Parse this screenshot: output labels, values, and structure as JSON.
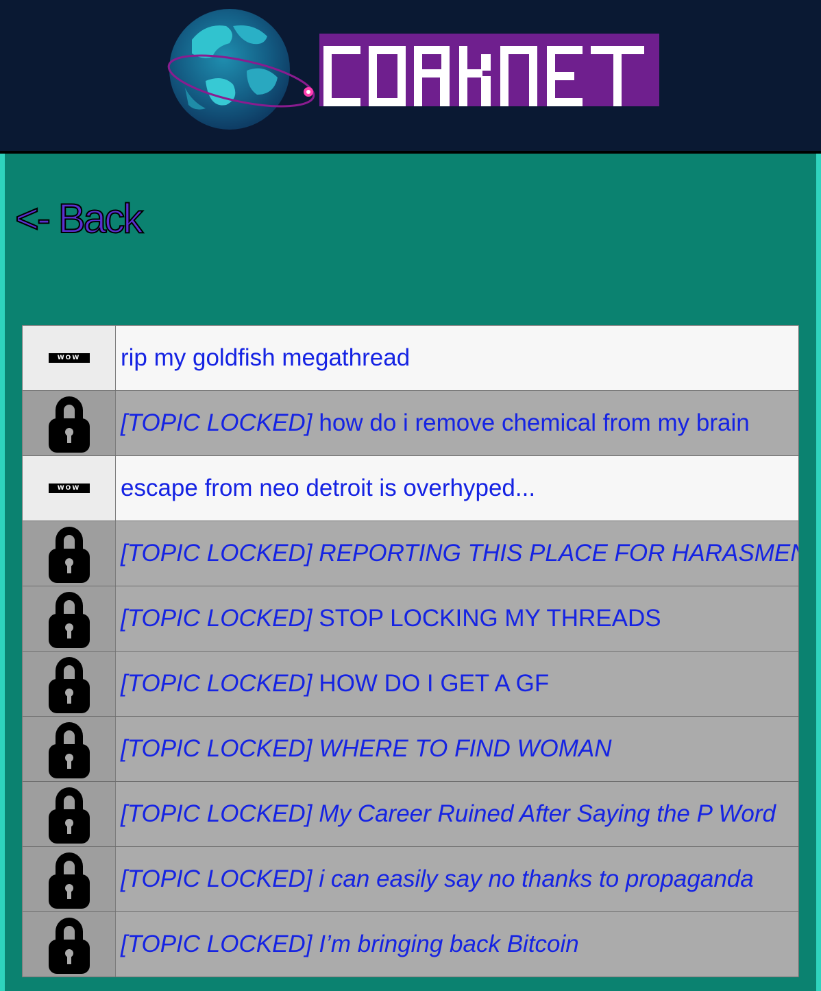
{
  "header": {
    "logo_text": "CORKNET",
    "logo_colors": {
      "band": "#6f1f8e",
      "letters": "#ffffff",
      "background": "#0a1933"
    }
  },
  "nav": {
    "back_label": "<- Back"
  },
  "badge_label": "WOW",
  "threads": [
    {
      "locked": false,
      "prefix": "",
      "title": "rip my goldfish megathread",
      "italic": false
    },
    {
      "locked": true,
      "prefix": "[TOPIC LOCKED]",
      "title": "how do i remove chemical from my brain",
      "italic": false
    },
    {
      "locked": false,
      "prefix": "",
      "title": "escape from neo detroit is overhyped...",
      "italic": false
    },
    {
      "locked": true,
      "prefix": "[TOPIC LOCKED]",
      "title": "REPORTING THIS PLACE FOR HARASMENT",
      "italic": true
    },
    {
      "locked": true,
      "prefix": "[TOPIC LOCKED]",
      "title": "STOP LOCKING MY THREADS",
      "italic": false
    },
    {
      "locked": true,
      "prefix": "[TOPIC LOCKED]",
      "title": "HOW DO I GET A GF",
      "italic": false
    },
    {
      "locked": true,
      "prefix": "[TOPIC LOCKED]",
      "title": "WHERE TO FIND WOMAN",
      "italic": true
    },
    {
      "locked": true,
      "prefix": "[TOPIC LOCKED]",
      "title": "My Career Ruined After Saying the P Word",
      "italic": true
    },
    {
      "locked": true,
      "prefix": "[TOPIC LOCKED]",
      "title": "i can easily say no thanks to propaganda",
      "italic": true
    },
    {
      "locked": true,
      "prefix": "[TOPIC LOCKED]",
      "title": "I’m bringing back Bitcoin",
      "italic": true
    }
  ],
  "icons": {
    "open": "wow-badge-icon",
    "locked": "padlock-icon"
  }
}
